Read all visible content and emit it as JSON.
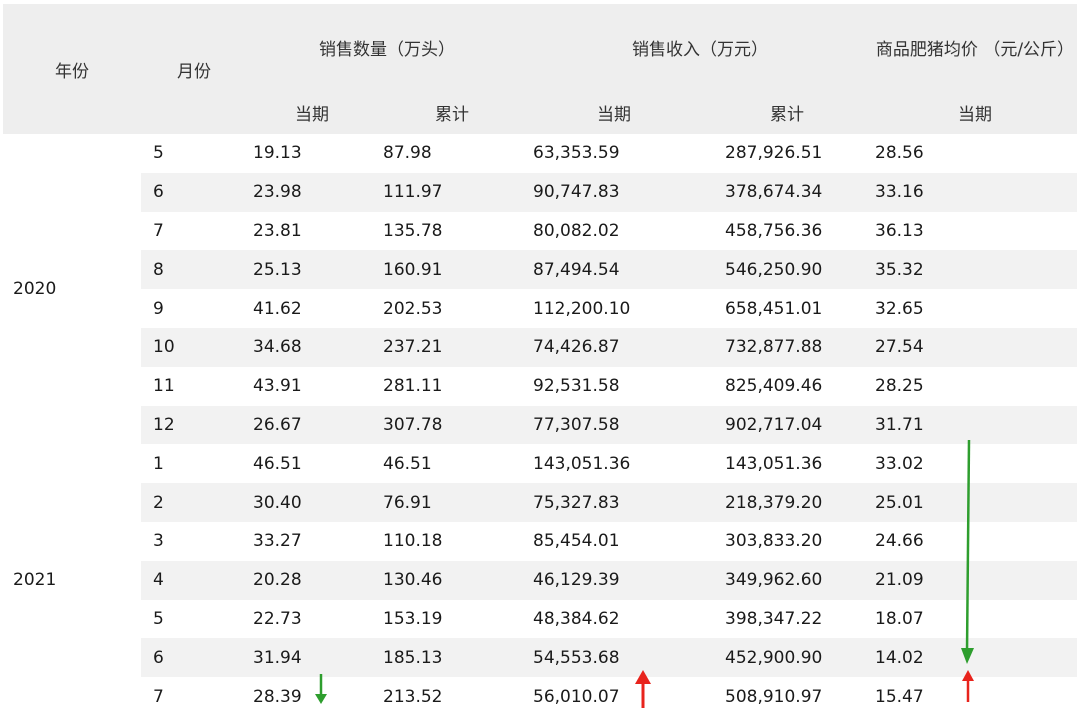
{
  "header": {
    "year": "年份",
    "month": "月份",
    "sales_qty": "销售数量（万头）",
    "sales_rev": "销售收入（万元）",
    "price": "商品肥猪均价 （元/公斤）",
    "current": "当期",
    "cumulative": "累计"
  },
  "groups": [
    {
      "year": "2020",
      "rows": [
        [
          "5",
          "19.13",
          "87.98",
          "63,353.59",
          "287,926.51",
          "28.56"
        ],
        [
          "6",
          "23.98",
          "111.97",
          "90,747.83",
          "378,674.34",
          "33.16"
        ],
        [
          "7",
          "23.81",
          "135.78",
          "80,082.02",
          "458,756.36",
          "36.13"
        ],
        [
          "8",
          "25.13",
          "160.91",
          "87,494.54",
          "546,250.90",
          "35.32"
        ],
        [
          "9",
          "41.62",
          "202.53",
          "112,200.10",
          "658,451.01",
          "32.65"
        ],
        [
          "10",
          "34.68",
          "237.21",
          "74,426.87",
          "732,877.88",
          "27.54"
        ],
        [
          "11",
          "43.91",
          "281.11",
          "92,531.58",
          "825,409.46",
          "28.25"
        ],
        [
          "12",
          "26.67",
          "307.78",
          "77,307.58",
          "902,717.04",
          "31.71"
        ]
      ]
    },
    {
      "year": "2021",
      "rows": [
        [
          "1",
          "46.51",
          "46.51",
          "143,051.36",
          "143,051.36",
          "33.02"
        ],
        [
          "2",
          "30.40",
          "76.91",
          "75,327.83",
          "218,379.20",
          "25.01"
        ],
        [
          "3",
          "33.27",
          "110.18",
          "85,454.01",
          "303,833.20",
          "24.66"
        ],
        [
          "4",
          "20.28",
          "130.46",
          "46,129.39",
          "349,962.60",
          "21.09"
        ],
        [
          "5",
          "22.73",
          "153.19",
          "48,384.62",
          "398,347.22",
          "18.07"
        ],
        [
          "6",
          "31.94",
          "185.13",
          "54,553.68",
          "452,900.90",
          "14.02"
        ],
        [
          "7",
          "28.39",
          "213.52",
          "56,010.07",
          "508,910.97",
          "15.47"
        ]
      ]
    }
  ],
  "annotations": {
    "down_color": "#2e9e2e",
    "up_color": "#e8231c",
    "qty_arrow": "down-arrow-icon",
    "rev_arrow": "up-arrow-icon",
    "price_long_arrow": "down-arrow-icon",
    "price_arrow": "up-arrow-icon"
  }
}
